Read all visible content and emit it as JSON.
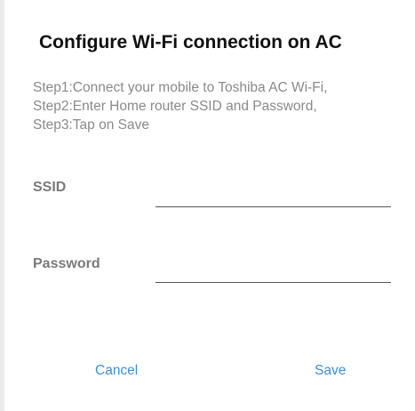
{
  "dialog": {
    "title": "Configure Wi-Fi connection on AC",
    "steps": [
      "Step1:Connect your mobile to Toshiba AC Wi-Fi,",
      "Step2:Enter Home router SSID and Password,",
      "Step3:Tap on Save"
    ],
    "fields": {
      "ssid": {
        "label": "SSID",
        "value": ""
      },
      "password": {
        "label": "Password",
        "value": ""
      }
    },
    "buttons": {
      "cancel": "Cancel",
      "save": "Save"
    },
    "colors": {
      "title": "#111111",
      "instructions": "#8a8a8a",
      "label": "#7a7a7a",
      "accent": "#3d8fd8"
    }
  }
}
